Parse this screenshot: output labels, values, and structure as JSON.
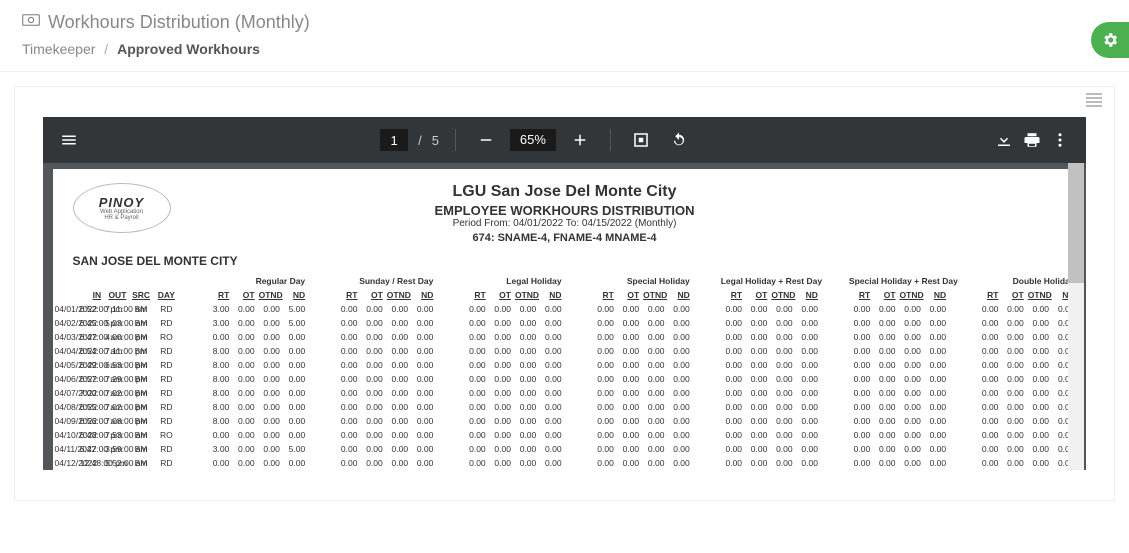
{
  "header": {
    "title": "Workhours Distribution (Monthly)",
    "breadcrumb_root": "Timekeeper",
    "breadcrumb_current": "Approved Workhours"
  },
  "pdf": {
    "page_current": "1",
    "page_total": "5",
    "zoom": "65%"
  },
  "doc": {
    "logo_brand": "PINOY",
    "logo_sub1": "Web Application",
    "logo_sub2": "HR & Payroll",
    "title": "LGU San Jose Del Monte City",
    "subtitle": "EMPLOYEE WORKHOURS DISTRIBUTION",
    "period": "Period From: 04/01/2022 To: 04/15/2022 (Monthly)",
    "employee": "674: SNAME-4, FNAME-4 MNAME-4",
    "dept": "SAN JOSE DEL MONTE CITY"
  },
  "table": {
    "groups": [
      "Regular Day",
      "Sunday / Rest Day",
      "Legal Holiday",
      "Special Holiday",
      "Legal Holiday + Rest Day",
      "Special Holiday + Rest Day",
      "Double Holiday"
    ],
    "front_cols": [
      "",
      "IN",
      "OUT",
      "SRC",
      "DAY"
    ],
    "sub_cols": [
      "RT",
      "OT",
      "OTND",
      "ND"
    ],
    "rows": [
      {
        "date": "04/01/2022",
        "in": "6:52:00 pm",
        "out": "7:11:00 am",
        "src": "BM",
        "day": "RD",
        "vals": [
          "3.00",
          "0.00",
          "0.00",
          "5.00"
        ]
      },
      {
        "date": "04/02/2022",
        "in": "6:45:00 pm",
        "out": "5:03:00 am",
        "src": "BM",
        "day": "RD",
        "vals": [
          "3.00",
          "0.00",
          "0.00",
          "5.00"
        ]
      },
      {
        "date": "04/03/2022",
        "in": "6:47:00 am",
        "out": "4:00:00 pm",
        "src": "BM",
        "day": "RO",
        "vals": [
          "0.00",
          "0.00",
          "0.00",
          "0.00"
        ]
      },
      {
        "date": "04/04/2022",
        "in": "6:54:00 am",
        "out": "7:11:00 pm",
        "src": "BM",
        "day": "RD",
        "vals": [
          "8.00",
          "0.00",
          "0.00",
          "0.00"
        ]
      },
      {
        "date": "04/05/2022",
        "in": "6:49:00 am",
        "out": "6:53:00 pm",
        "src": "BM",
        "day": "RD",
        "vals": [
          "8.00",
          "0.00",
          "0.00",
          "0.00"
        ]
      },
      {
        "date": "04/06/2022",
        "in": "6:57:00 am",
        "out": "7:29:00 pm",
        "src": "BM",
        "day": "RD",
        "vals": [
          "8.00",
          "0.00",
          "0.00",
          "0.00"
        ]
      },
      {
        "date": "04/07/2022",
        "in": "7:00:00 am",
        "out": "7:02:00 pm",
        "src": "BM",
        "day": "RD",
        "vals": [
          "8.00",
          "0.00",
          "0.00",
          "0.00"
        ]
      },
      {
        "date": "04/08/2022",
        "in": "6:55:00 am",
        "out": "7:02:00 pm",
        "src": "BM",
        "day": "RD",
        "vals": [
          "8.00",
          "0.00",
          "0.00",
          "0.00"
        ]
      },
      {
        "date": "04/09/2022",
        "in": "6:56:00 am",
        "out": "7:08:00 pm",
        "src": "BM",
        "day": "RD",
        "vals": [
          "8.00",
          "0.00",
          "0.00",
          "0.00"
        ]
      },
      {
        "date": "04/10/2022",
        "in": "6:48:00 pm",
        "out": "7:53:00 am",
        "src": "BM",
        "day": "RO",
        "vals": [
          "0.00",
          "0.00",
          "0.00",
          "0.00"
        ]
      },
      {
        "date": "04/11/2022",
        "in": "6:47:00 pm",
        "out": "3:59:00 am",
        "src": "BM",
        "day": "RD",
        "vals": [
          "3.00",
          "0.00",
          "0.00",
          "5.00"
        ]
      },
      {
        "date": "04/12/2022",
        "in": "12:48:00 pm",
        "out": "5:52:00 am",
        "src": "BM",
        "day": "RD",
        "vals": [
          "0.00",
          "0.00",
          "0.00",
          "0.00"
        ]
      }
    ]
  }
}
